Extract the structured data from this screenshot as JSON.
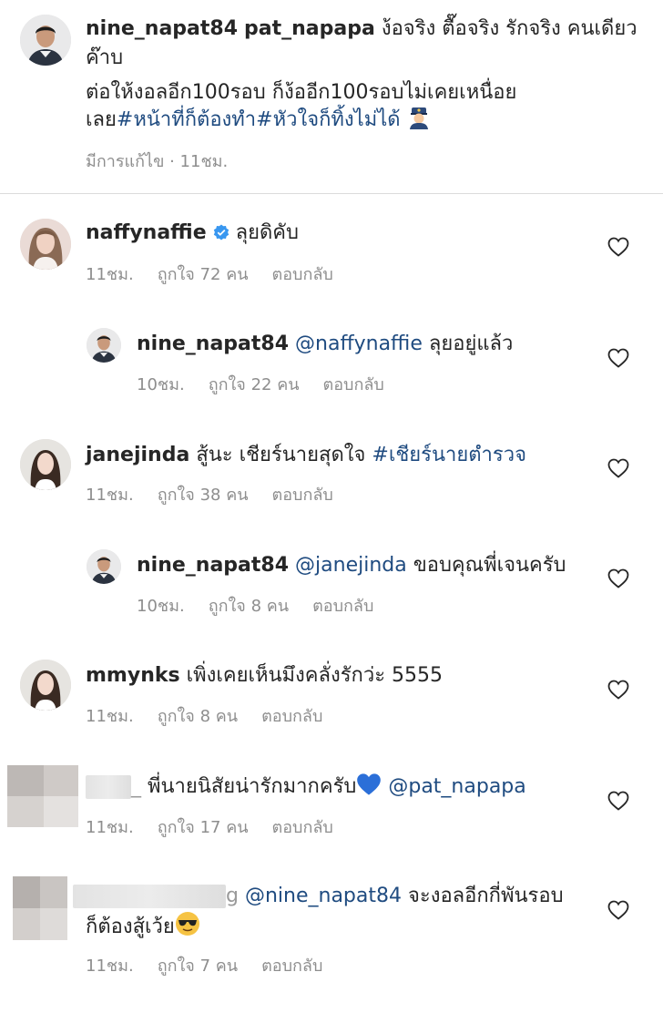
{
  "caption": {
    "username": "nine_napat84",
    "mention": "pat_napapa",
    "line1_text": "ง้อจริง ตื๊อจริง รักจริง คนเดียว",
    "line2_text": "ค๊าบ",
    "line3_text": "ต่อให้งอลอีก100รอบ ก็ง้ออีก100รอบไม่เคยเหนื่อย",
    "line4_text": "เลย",
    "hashtag1": "#หน้าที่ก็ต้องทำ",
    "hashtag2": "#หัวใจก็ทิ้งไม่ได้",
    "emoji": "police-officer-emoji",
    "meta": "มีการแก้ไข · 11ชม."
  },
  "comments": [
    {
      "username": "naffynaffie",
      "verified": true,
      "text": "ลุยดิคับ",
      "time": "11ชม.",
      "likes": "ถูกใจ 72 คน",
      "reply": "ตอบกลับ"
    },
    {
      "username": "nine_napat84",
      "mention": "@naffynaffie",
      "text": "ลุยอยู่แล้ว",
      "time": "10ชม.",
      "likes": "ถูกใจ 22 คน",
      "reply": "ตอบกลับ"
    },
    {
      "username": "janejinda",
      "text": "สู้นะ เชียร์นายสุดใจ",
      "hashtag": "#เชียร์นายตำรวจ",
      "time": "11ชม.",
      "likes": "ถูกใจ 38 คน",
      "reply": "ตอบกลับ"
    },
    {
      "username": "nine_napat84",
      "mention": "@janejinda",
      "text": "ขอบคุณพี่เจนครับ",
      "time": "10ชม.",
      "likes": "ถูกใจ 8 คน",
      "reply": "ตอบกลับ"
    },
    {
      "username": "mmynks",
      "text": "เพิ่งเคยเห็นมึงคลั่งรักว่ะ 5555",
      "time": "11ชม.",
      "likes": "ถูกใจ 8 คน",
      "reply": "ตอบกลับ"
    },
    {
      "username_hidden": "_",
      "text": "พี่นายนิสัยน่ารักมากครับ",
      "emoji": "blue-heart-emoji",
      "mention": "@pat_napapa",
      "time": "11ชม.",
      "likes": "ถูกใจ 17 คน",
      "reply": "ตอบกลับ"
    },
    {
      "username_hidden": "g",
      "mention": "@nine_napat84",
      "text": "จะงอลอีกกี่พันรอบ",
      "text2": "ก็ต้องสู้เว้ย",
      "emoji": "sunglasses-emoji",
      "time": "11ชม.",
      "likes": "ถูกใจ 7 คน",
      "reply": "ตอบกลับ"
    }
  ],
  "colors": {
    "link": "#1f4b80",
    "meta": "#8e8e8e",
    "verified": "#3897f0",
    "divider": "#dbdbdb"
  }
}
